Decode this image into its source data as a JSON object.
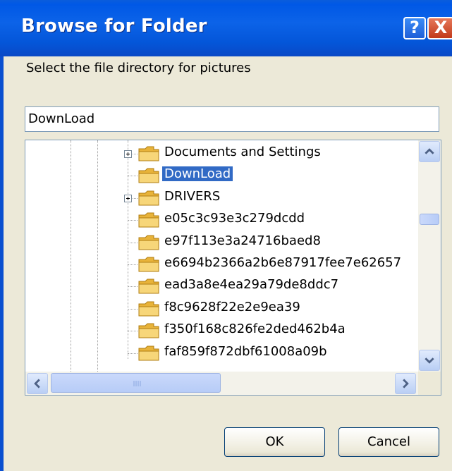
{
  "window": {
    "title": "Browse for Folder",
    "help_label": "?",
    "close_label": "X"
  },
  "prompt": "Select the file directory for pictures",
  "path_value": "DownLoad",
  "tree": {
    "items": [
      {
        "label": "Documents and Settings",
        "expandable": true,
        "selected": false
      },
      {
        "label": "DownLoad",
        "expandable": false,
        "selected": true
      },
      {
        "label": "DRIVERS",
        "expandable": true,
        "selected": false
      },
      {
        "label": "e05c3c93e3c279dcdd",
        "expandable": false,
        "selected": false
      },
      {
        "label": "e97f113e3a24716baed8",
        "expandable": false,
        "selected": false
      },
      {
        "label": "e6694b2366a2b6e87917fee7e62657",
        "expandable": false,
        "selected": false
      },
      {
        "label": "ead3a8e4ea29a79de8ddc7",
        "expandable": false,
        "selected": false
      },
      {
        "label": "f8c9628f22e2e9ea39",
        "expandable": false,
        "selected": false
      },
      {
        "label": "f350f168c826fe2ded462b4a",
        "expandable": false,
        "selected": false
      },
      {
        "label": "faf859f872dbf61008a09b",
        "expandable": false,
        "selected": false
      }
    ]
  },
  "buttons": {
    "ok_label": "OK",
    "cancel_label": "Cancel"
  },
  "colors": {
    "title_bar": "#0058e6",
    "selection": "#316ac5",
    "dialog_bg": "#ece9d8"
  },
  "icons": [
    "help-icon",
    "close-icon",
    "folder-icon",
    "expand-plus-icon",
    "scroll-up-icon",
    "scroll-down-icon",
    "scroll-left-icon",
    "scroll-right-icon"
  ]
}
